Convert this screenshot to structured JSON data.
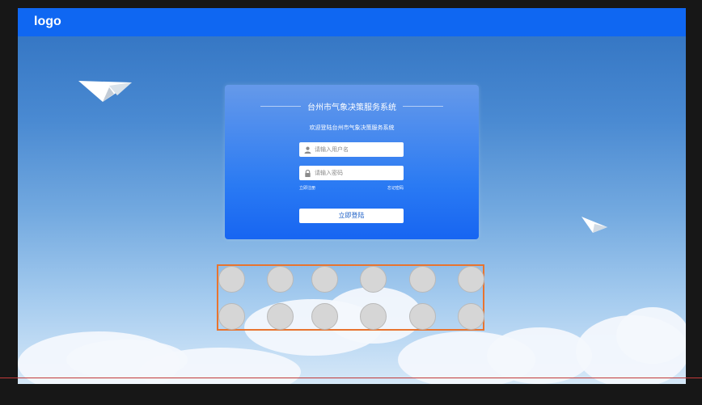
{
  "header": {
    "logo": "logo"
  },
  "login": {
    "title": "台州市气象决策服务系统",
    "subtitle": "欢迎登陆台州市气象决策服务系统",
    "username_placeholder": "请输入用户名",
    "password_placeholder": "请输入密码",
    "register_link": "立即注册",
    "forgot_link": "忘记密码",
    "login_button": "立即登陆"
  },
  "icons": [
    "user-icon",
    "lock-icon",
    "paper-plane-icon"
  ],
  "colors": {
    "topbar": "#0f67f2",
    "card_bottom": "#1765f2",
    "button_text": "#1a5ec6",
    "selection_border": "#e8742f",
    "placeholder_circle": "#d6d6d6"
  },
  "placeholder_circles": {
    "rows": 2,
    "columns": 6
  }
}
